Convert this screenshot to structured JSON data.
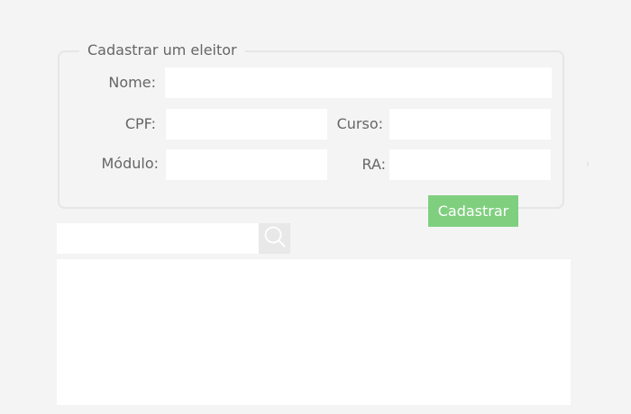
{
  "form": {
    "legend": "Cadastrar um eleitor",
    "nome_label": "Nome:",
    "nome_value": "",
    "cpf_label": "CPF:",
    "cpf_value": "",
    "curso_label": "Curso:",
    "curso_value": "",
    "modulo_label": "Módulo:",
    "modulo_value": "",
    "ra_label": "RA:",
    "ra_value": "",
    "submit_label": "Cadastrar",
    "submit_color": "#7fcf7f"
  },
  "search": {
    "value": "",
    "icon": "search-icon"
  }
}
